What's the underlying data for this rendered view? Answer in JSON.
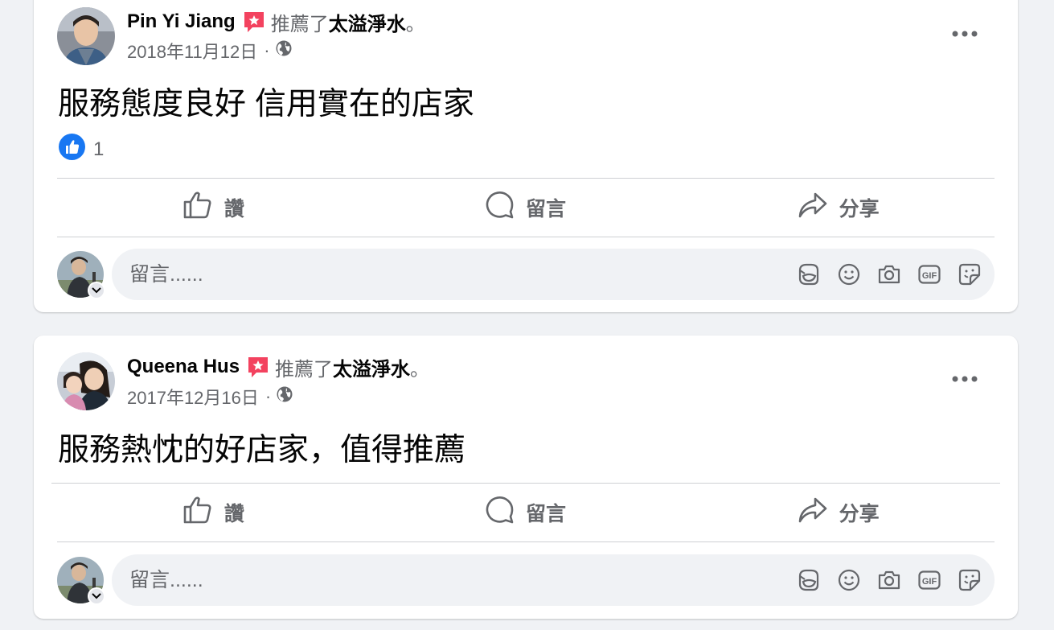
{
  "posts": [
    {
      "author": "Pin Yi Jiang",
      "recommend_text": "推薦了",
      "page_name": "太溢淨水",
      "period": "。",
      "date": "2018年11月12日",
      "separator": "·",
      "audience_icon": "globe-icon",
      "body": "服務態度良好 信用實在的店家",
      "reaction_icon": "like-reaction-icon",
      "reaction_count": "1"
    },
    {
      "author": "Queena Hus",
      "recommend_text": "推薦了",
      "page_name": "太溢淨水",
      "period": "。",
      "date": "2017年12月16日",
      "separator": "·",
      "audience_icon": "globe-icon",
      "body": "服務熱忱的好店家，值得推薦"
    }
  ],
  "actions": {
    "like_label": "讚",
    "comment_label": "留言",
    "share_label": "分享"
  },
  "composer": {
    "placeholder": "留言......",
    "icons": [
      "avatar-sticker-icon",
      "emoji-icon",
      "camera-icon",
      "gif-icon",
      "sticker-icon"
    ]
  },
  "colors": {
    "background": "#f0f2f5",
    "card": "#ffffff",
    "secondary_text": "#65676b",
    "like_blue": "#1877f2",
    "recommend_red": "#f3425f"
  }
}
